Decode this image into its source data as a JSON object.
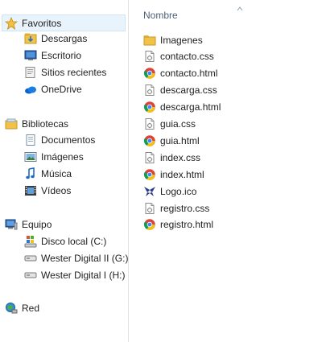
{
  "navigation": {
    "favorites": {
      "label": "Favoritos",
      "items": [
        {
          "label": "Descargas",
          "icon": "downloads-folder-icon"
        },
        {
          "label": "Escritorio",
          "icon": "desktop-icon"
        },
        {
          "label": "Sitios recientes",
          "icon": "recent-places-icon"
        },
        {
          "label": "OneDrive",
          "icon": "onedrive-cloud-icon"
        }
      ]
    },
    "libraries": {
      "label": "Bibliotecas",
      "items": [
        {
          "label": "Documentos",
          "icon": "documents-icon"
        },
        {
          "label": "Imágenes",
          "icon": "pictures-icon"
        },
        {
          "label": "Música",
          "icon": "music-icon"
        },
        {
          "label": "Vídeos",
          "icon": "videos-icon"
        }
      ]
    },
    "computer": {
      "label": "Equipo",
      "items": [
        {
          "label": "Disco local (C:)",
          "icon": "windows-drive-icon"
        },
        {
          "label": "Wester Digital II (G:)",
          "icon": "hard-drive-icon"
        },
        {
          "label": "Wester Digital I (H:)",
          "icon": "hard-drive-icon"
        }
      ]
    },
    "network": {
      "label": "Red"
    }
  },
  "file_list": {
    "column_header": "Nombre",
    "files": [
      {
        "name": "Imagenes",
        "icon": "folder-icon"
      },
      {
        "name": "contacto.css",
        "icon": "css-file-icon"
      },
      {
        "name": "contacto.html",
        "icon": "chrome-html-icon"
      },
      {
        "name": "descarga.css",
        "icon": "css-file-icon"
      },
      {
        "name": "descarga.html",
        "icon": "chrome-html-icon"
      },
      {
        "name": "guia.css",
        "icon": "css-file-icon"
      },
      {
        "name": "guia.html",
        "icon": "chrome-html-icon"
      },
      {
        "name": "index.css",
        "icon": "css-file-icon"
      },
      {
        "name": "index.html",
        "icon": "chrome-html-icon"
      },
      {
        "name": "Logo.ico",
        "icon": "logo-ico-icon"
      },
      {
        "name": "registro.css",
        "icon": "css-file-icon"
      },
      {
        "name": "registro.html",
        "icon": "chrome-html-icon"
      }
    ]
  },
  "colors": {
    "selection_bg": "#e8f3fc",
    "header_text": "#4c607a",
    "folder_yellow": "#f0c24a"
  }
}
